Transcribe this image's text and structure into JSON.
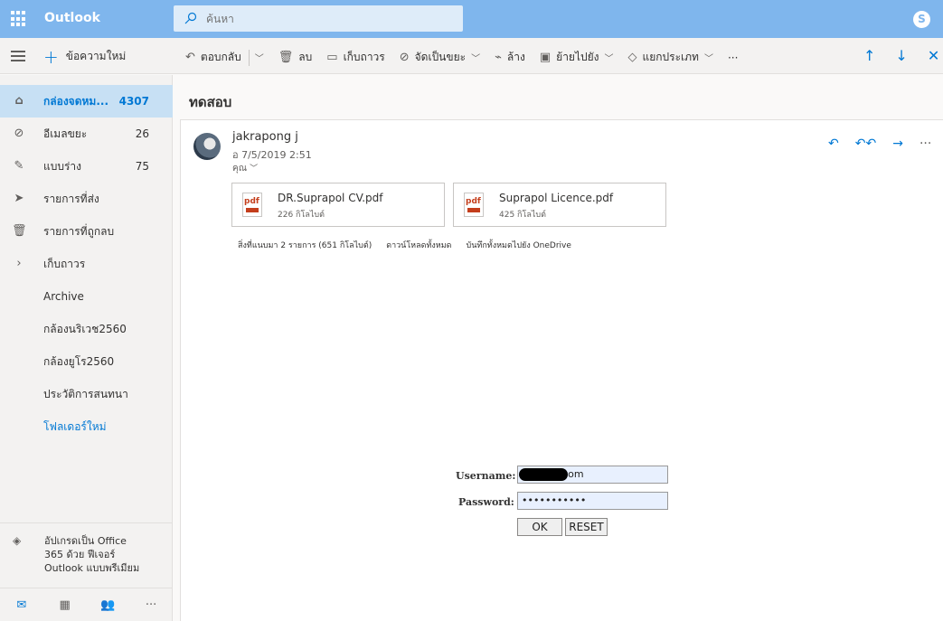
{
  "app": {
    "brand": "Outlook"
  },
  "search": {
    "placeholder": "ค้นหา"
  },
  "cmdbar": {
    "new_message": "ข้อความใหม่",
    "reply": "ตอบกลับ",
    "delete": "ลบ",
    "archive": "เก็บถาวร",
    "junk": "จัดเป็นขยะ",
    "sweep": "ล้าง",
    "move_to": "ย้ายไปยัง",
    "categorize": "แยกประเภท",
    "more": "···"
  },
  "sidebar": {
    "items": [
      {
        "label": "กล่องจดหม...",
        "count": "4307",
        "icon": "inbox-icon"
      },
      {
        "label": "อีเมลขยะ",
        "count": "26",
        "icon": "block-icon"
      },
      {
        "label": "แบบร่าง",
        "count": "75",
        "icon": "pencil-icon"
      },
      {
        "label": "รายการที่ส่ง",
        "count": "",
        "icon": "send-icon"
      },
      {
        "label": "รายการที่ถูกลบ",
        "count": "",
        "icon": "trash-icon"
      },
      {
        "label": "เก็บถาวร",
        "count": "",
        "icon": "chevron-right-icon"
      },
      {
        "label": "Archive",
        "count": ""
      },
      {
        "label": "กล้องนริเวช2560",
        "count": ""
      },
      {
        "label": "กล้องยูโร2560",
        "count": ""
      },
      {
        "label": "ประวัติการสนทนา",
        "count": ""
      },
      {
        "label": "โฟลเดอร์ใหม่",
        "count": ""
      }
    ],
    "promo_line1": "อัปเกรดเป็น Office",
    "promo_line2": "365 ด้วย ฟีเจอร์",
    "promo_line3": "Outlook แบบพรีเมียม"
  },
  "message": {
    "subject": "ทดสอบ",
    "sender": "jakrapong j",
    "date": "อ 7/5/2019 2:51",
    "to": "คุณ",
    "attachments": [
      {
        "name": "DR.Suprapol CV.pdf",
        "size": "226 กิโลไบต์",
        "type": "pdf"
      },
      {
        "name": "Suprapol Licence.pdf",
        "size": "425 กิโลไบต์",
        "type": "pdf"
      }
    ],
    "attachments_summary": "สิ่งที่แนบมา 2 รายการ (651 กิโลไบต์)",
    "download_all": "ดาวน์โหลดทั้งหมด",
    "save_all": "บันทึกทั้งหมดไปยัง OneDrive"
  },
  "login_form": {
    "username_label": "Username:",
    "username_value": "        hotmail.com",
    "password_label": "Password:",
    "password_value": "•••••••••••",
    "ok_label": "OK",
    "reset_label": "RESET"
  }
}
